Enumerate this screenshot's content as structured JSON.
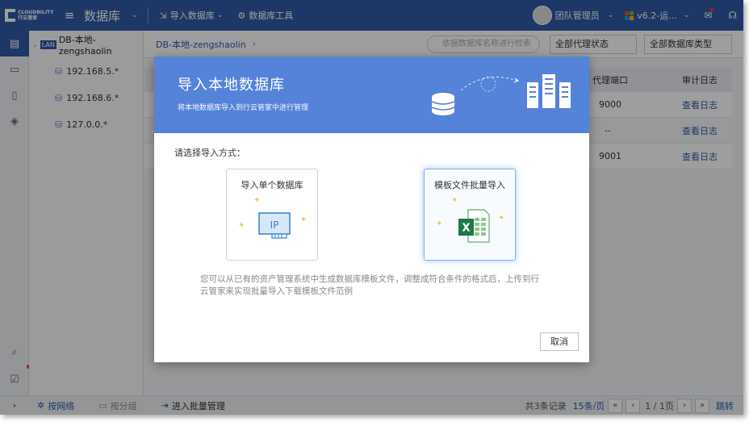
{
  "app": {
    "logo_text": "CLOUDBILITY 行云管家",
    "title": "数据库",
    "menu": [
      "导入数据库",
      "数据库工具"
    ],
    "user": "团队管理员",
    "version": "v6.2-运...",
    "colors": {
      "brand": "#2f5aa6",
      "modal_header": "#5583d9",
      "link": "#2f5aa6",
      "win_red": "#f25022",
      "win_green": "#7fba00",
      "win_blue": "#00a4ef",
      "win_yellow": "#ffb900"
    }
  },
  "tree": {
    "badge": "LAN",
    "root": "DB-本地-zengshaolin",
    "nodes": [
      "192.168.5.*",
      "192.168.6.*",
      "127.0.0.*"
    ]
  },
  "main": {
    "breadcrumb": "DB-本地-zengshaolin",
    "breadcrumb_caret": "›",
    "search_placeholder": "依据数据库名称进行检索",
    "filter_proxy": "全部代理状态",
    "filter_type": "全部数据库类型",
    "columns": {
      "port": "代理端口",
      "log": "审计日志"
    },
    "rows": [
      {
        "port": "9000",
        "log": "查看日志"
      },
      {
        "port": "--",
        "log": "查看日志"
      },
      {
        "port": "9001",
        "log": "查看日志"
      }
    ]
  },
  "footer": {
    "tab_network": "按网络",
    "tab_group": "按分组",
    "batch": "进入批量管理",
    "total": "共3条记录",
    "per_page": "15条/页",
    "page": "1 / 1页",
    "jump": "跳转"
  },
  "modal": {
    "title": "导入本地数据库",
    "subtitle": "将本地数据库导入到行云管家中进行管理",
    "prompt": "请选择导入方式：",
    "option_single": "导入单个数据库",
    "option_single_icon_text": "IP",
    "option_batch": "模板文件批量导入",
    "option_batch_icon_text": "X",
    "note": "您可以从已有的资产管理系统中生成数据库模板文件，调整成符合条件的格式后，上传到行云管家来实现批量导入下载模板文件范例",
    "cancel": "取消"
  }
}
